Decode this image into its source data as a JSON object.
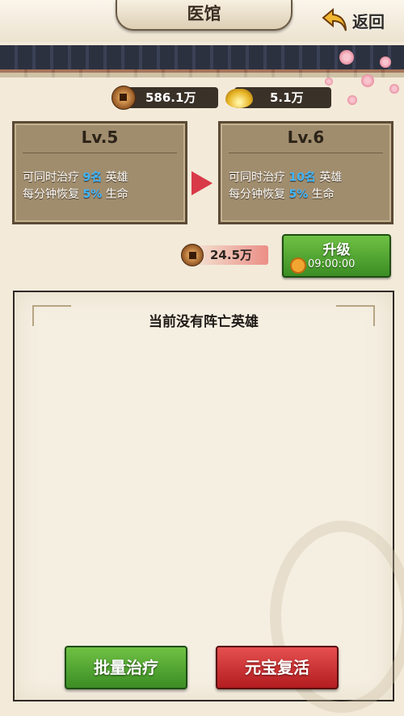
{
  "header": {
    "title": "医馆",
    "back_label": "返回"
  },
  "resources": {
    "copper": "586.1万",
    "gold_ingot": "5.1万"
  },
  "current_level": {
    "label": "Lv.5",
    "line1_prefix": "可同时治疗 ",
    "line1_value": "9名",
    "line1_suffix": " 英雄",
    "line2_prefix": "每分钟恢复 ",
    "line2_value": "5%",
    "line2_suffix": " 生命"
  },
  "next_level": {
    "label": "Lv.6",
    "line1_prefix": "可同时治疗 ",
    "line1_value": "10名",
    "line1_suffix": " 英雄",
    "line2_prefix": "每分钟恢复 ",
    "line2_value": "5%",
    "line2_suffix": " 生命"
  },
  "upgrade": {
    "cost": "24.5万",
    "label": "升级",
    "time": "09:00:00"
  },
  "panel": {
    "empty_message": "当前没有阵亡英雄"
  },
  "actions": {
    "batch_heal": "批量治疗",
    "ingot_revive": "元宝复活"
  },
  "colors": {
    "highlight": "#3fb6ff",
    "green_button": "#4fa632",
    "red_button": "#cc2e30",
    "arrow": "#d83a48"
  }
}
